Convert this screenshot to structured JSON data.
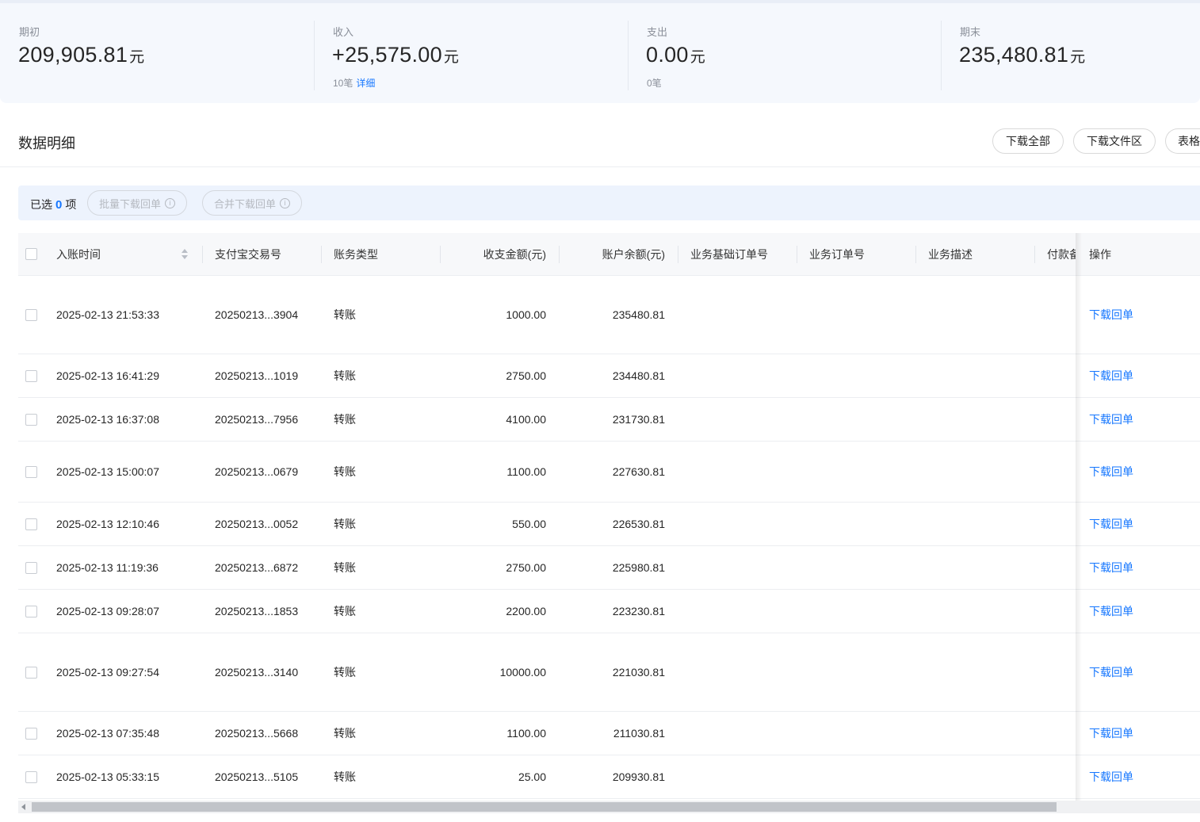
{
  "summary": [
    {
      "label": "期初",
      "amount": "209,905.81",
      "unit": "元",
      "sub_count": "",
      "sub_link": ""
    },
    {
      "label": "收入",
      "amount": "+25,575.00",
      "unit": "元",
      "sub_count": "10笔",
      "sub_link": "详细"
    },
    {
      "label": "支出",
      "amount": "0.00",
      "unit": "元",
      "sub_count": "0笔",
      "sub_link": ""
    },
    {
      "label": "期末",
      "amount": "235,480.81",
      "unit": "元",
      "sub_count": "",
      "sub_link": ""
    }
  ],
  "section": {
    "title": "数据明细",
    "buttons": {
      "download_all": "下载全部",
      "download_files": "下载文件区",
      "table": "表格"
    }
  },
  "selection": {
    "prefix": "已选",
    "count": "0",
    "suffix": "项",
    "batch_download": "批量下载回单",
    "merge_download": "合并下载回单",
    "info_glyph": "i"
  },
  "table": {
    "columns": {
      "time": "入账时间",
      "trade_no": "支付宝交易号",
      "type": "账务类型",
      "amount": "收支金额(元)",
      "balance": "账户余额(元)",
      "base_order": "业务基础订单号",
      "order": "业务订单号",
      "desc": "业务描述",
      "remark": "付款备注",
      "action": "操作"
    },
    "rows": [
      {
        "time": "2025-02-13 21:53:33",
        "trade_no": "20250213...3904",
        "type": "转账",
        "amount": "1000.00",
        "balance": "235480.81",
        "action": "下载回单"
      },
      {
        "time": "2025-02-13 16:41:29",
        "trade_no": "20250213...1019",
        "type": "转账",
        "amount": "2750.00",
        "balance": "234480.81",
        "action": "下载回单"
      },
      {
        "time": "2025-02-13 16:37:08",
        "trade_no": "20250213...7956",
        "type": "转账",
        "amount": "4100.00",
        "balance": "231730.81",
        "action": "下载回单"
      },
      {
        "time": "2025-02-13 15:00:07",
        "trade_no": "20250213...0679",
        "type": "转账",
        "amount": "1100.00",
        "balance": "227630.81",
        "action": "下载回单"
      },
      {
        "time": "2025-02-13 12:10:46",
        "trade_no": "20250213...0052",
        "type": "转账",
        "amount": "550.00",
        "balance": "226530.81",
        "action": "下载回单"
      },
      {
        "time": "2025-02-13 11:19:36",
        "trade_no": "20250213...6872",
        "type": "转账",
        "amount": "2750.00",
        "balance": "225980.81",
        "action": "下载回单"
      },
      {
        "time": "2025-02-13 09:28:07",
        "trade_no": "20250213...1853",
        "type": "转账",
        "amount": "2200.00",
        "balance": "223230.81",
        "action": "下载回单"
      },
      {
        "time": "2025-02-13 09:27:54",
        "trade_no": "20250213...3140",
        "type": "转账",
        "amount": "10000.00",
        "balance": "221030.81",
        "action": "下载回单"
      },
      {
        "time": "2025-02-13 07:35:48",
        "trade_no": "20250213...5668",
        "type": "转账",
        "amount": "1100.00",
        "balance": "211030.81",
        "action": "下载回单"
      },
      {
        "time": "2025-02-13 05:33:15",
        "trade_no": "20250213...5105",
        "type": "转账",
        "amount": "25.00",
        "balance": "209930.81",
        "action": "下载回单"
      }
    ]
  },
  "colors": {
    "accent": "#1677ff",
    "summary_bg": "#f5f8fd",
    "select_bar_bg": "#edf3fd"
  }
}
